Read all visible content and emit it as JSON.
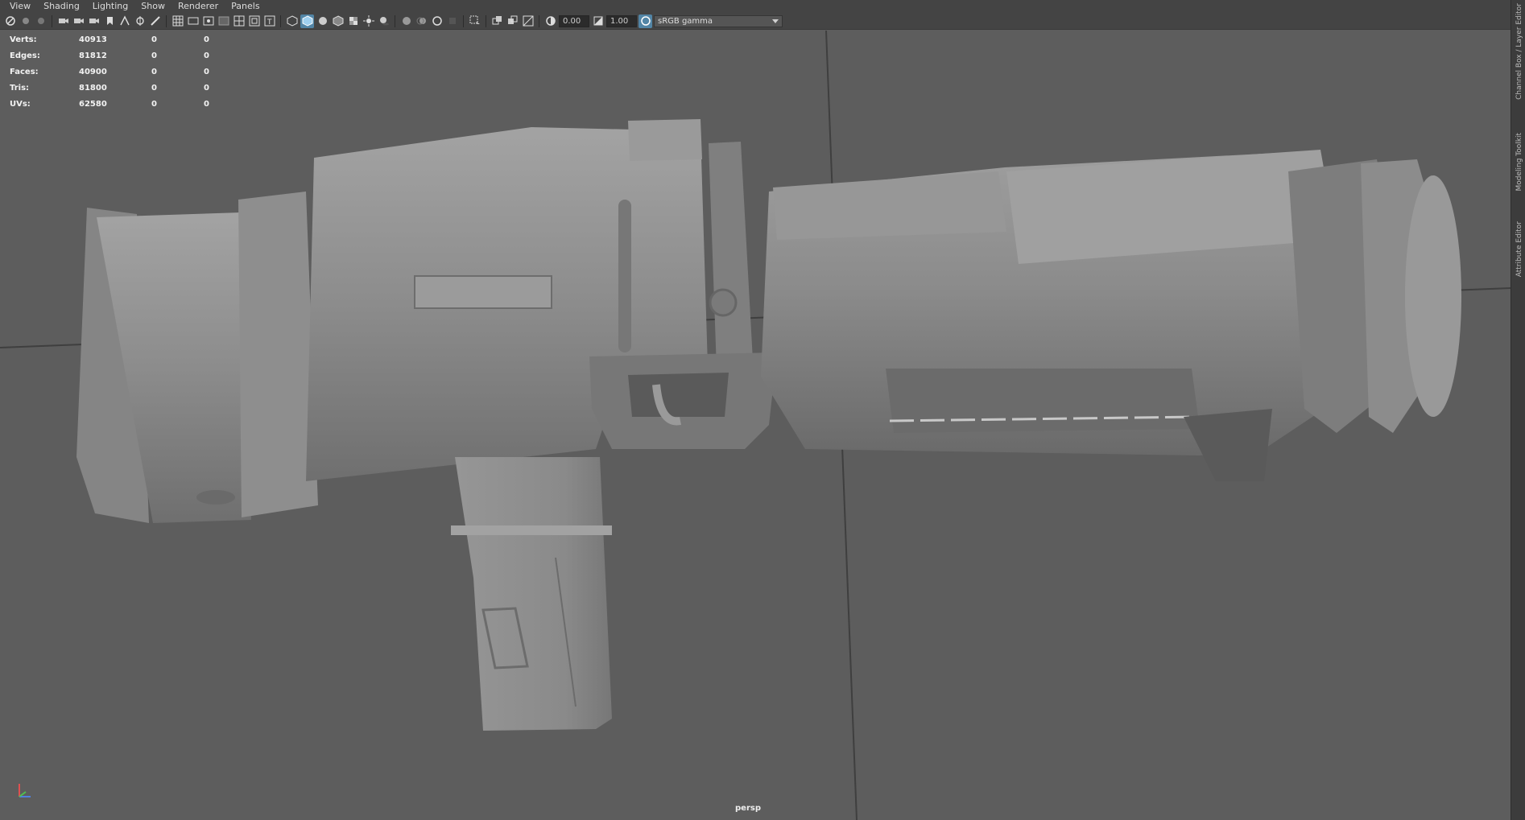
{
  "menu": {
    "items": [
      "View",
      "Shading",
      "Lighting",
      "Show",
      "Renderer",
      "Panels"
    ]
  },
  "toolbar": {
    "exposure_value": "0.00",
    "gamma_value": "1.00",
    "color_space": "sRGB gamma",
    "icons": [
      "camera-select-icon",
      "bookmark-icon",
      "image-plane-icon",
      "two-d-pan-icon",
      "grease-pencil-icon",
      "grid-icon",
      "film-gate-icon",
      "resolution-gate-icon",
      "safe-action-icon",
      "wireframe-icon",
      "smooth-shade-icon",
      "wireframe-on-shaded-icon",
      "textured-icon",
      "lighting-icon",
      "shadows-icon",
      "ambient-occlusion-icon",
      "motion-blur-icon",
      "antialias-icon",
      "isolate-icon",
      "xray-icon",
      "xray-joints-icon",
      "backface-icon"
    ]
  },
  "hud": {
    "rows": [
      {
        "label": "Verts:",
        "value": "40913",
        "selected": "0",
        "component": "0"
      },
      {
        "label": "Edges:",
        "value": "81812",
        "selected": "0",
        "component": "0"
      },
      {
        "label": "Faces:",
        "value": "40900",
        "selected": "0",
        "component": "0"
      },
      {
        "label": "Tris:",
        "value": "81800",
        "selected": "0",
        "component": "0"
      },
      {
        "label": "UVs:",
        "value": "62580",
        "selected": "0",
        "component": "0"
      }
    ]
  },
  "viewport": {
    "camera": "persp",
    "background_color": "#5d5d5d",
    "model_color": "#8a8a8a"
  },
  "side_tabs": [
    "Channel Box / Layer Editor",
    "Modeling Toolkit",
    "Attribute Editor"
  ]
}
